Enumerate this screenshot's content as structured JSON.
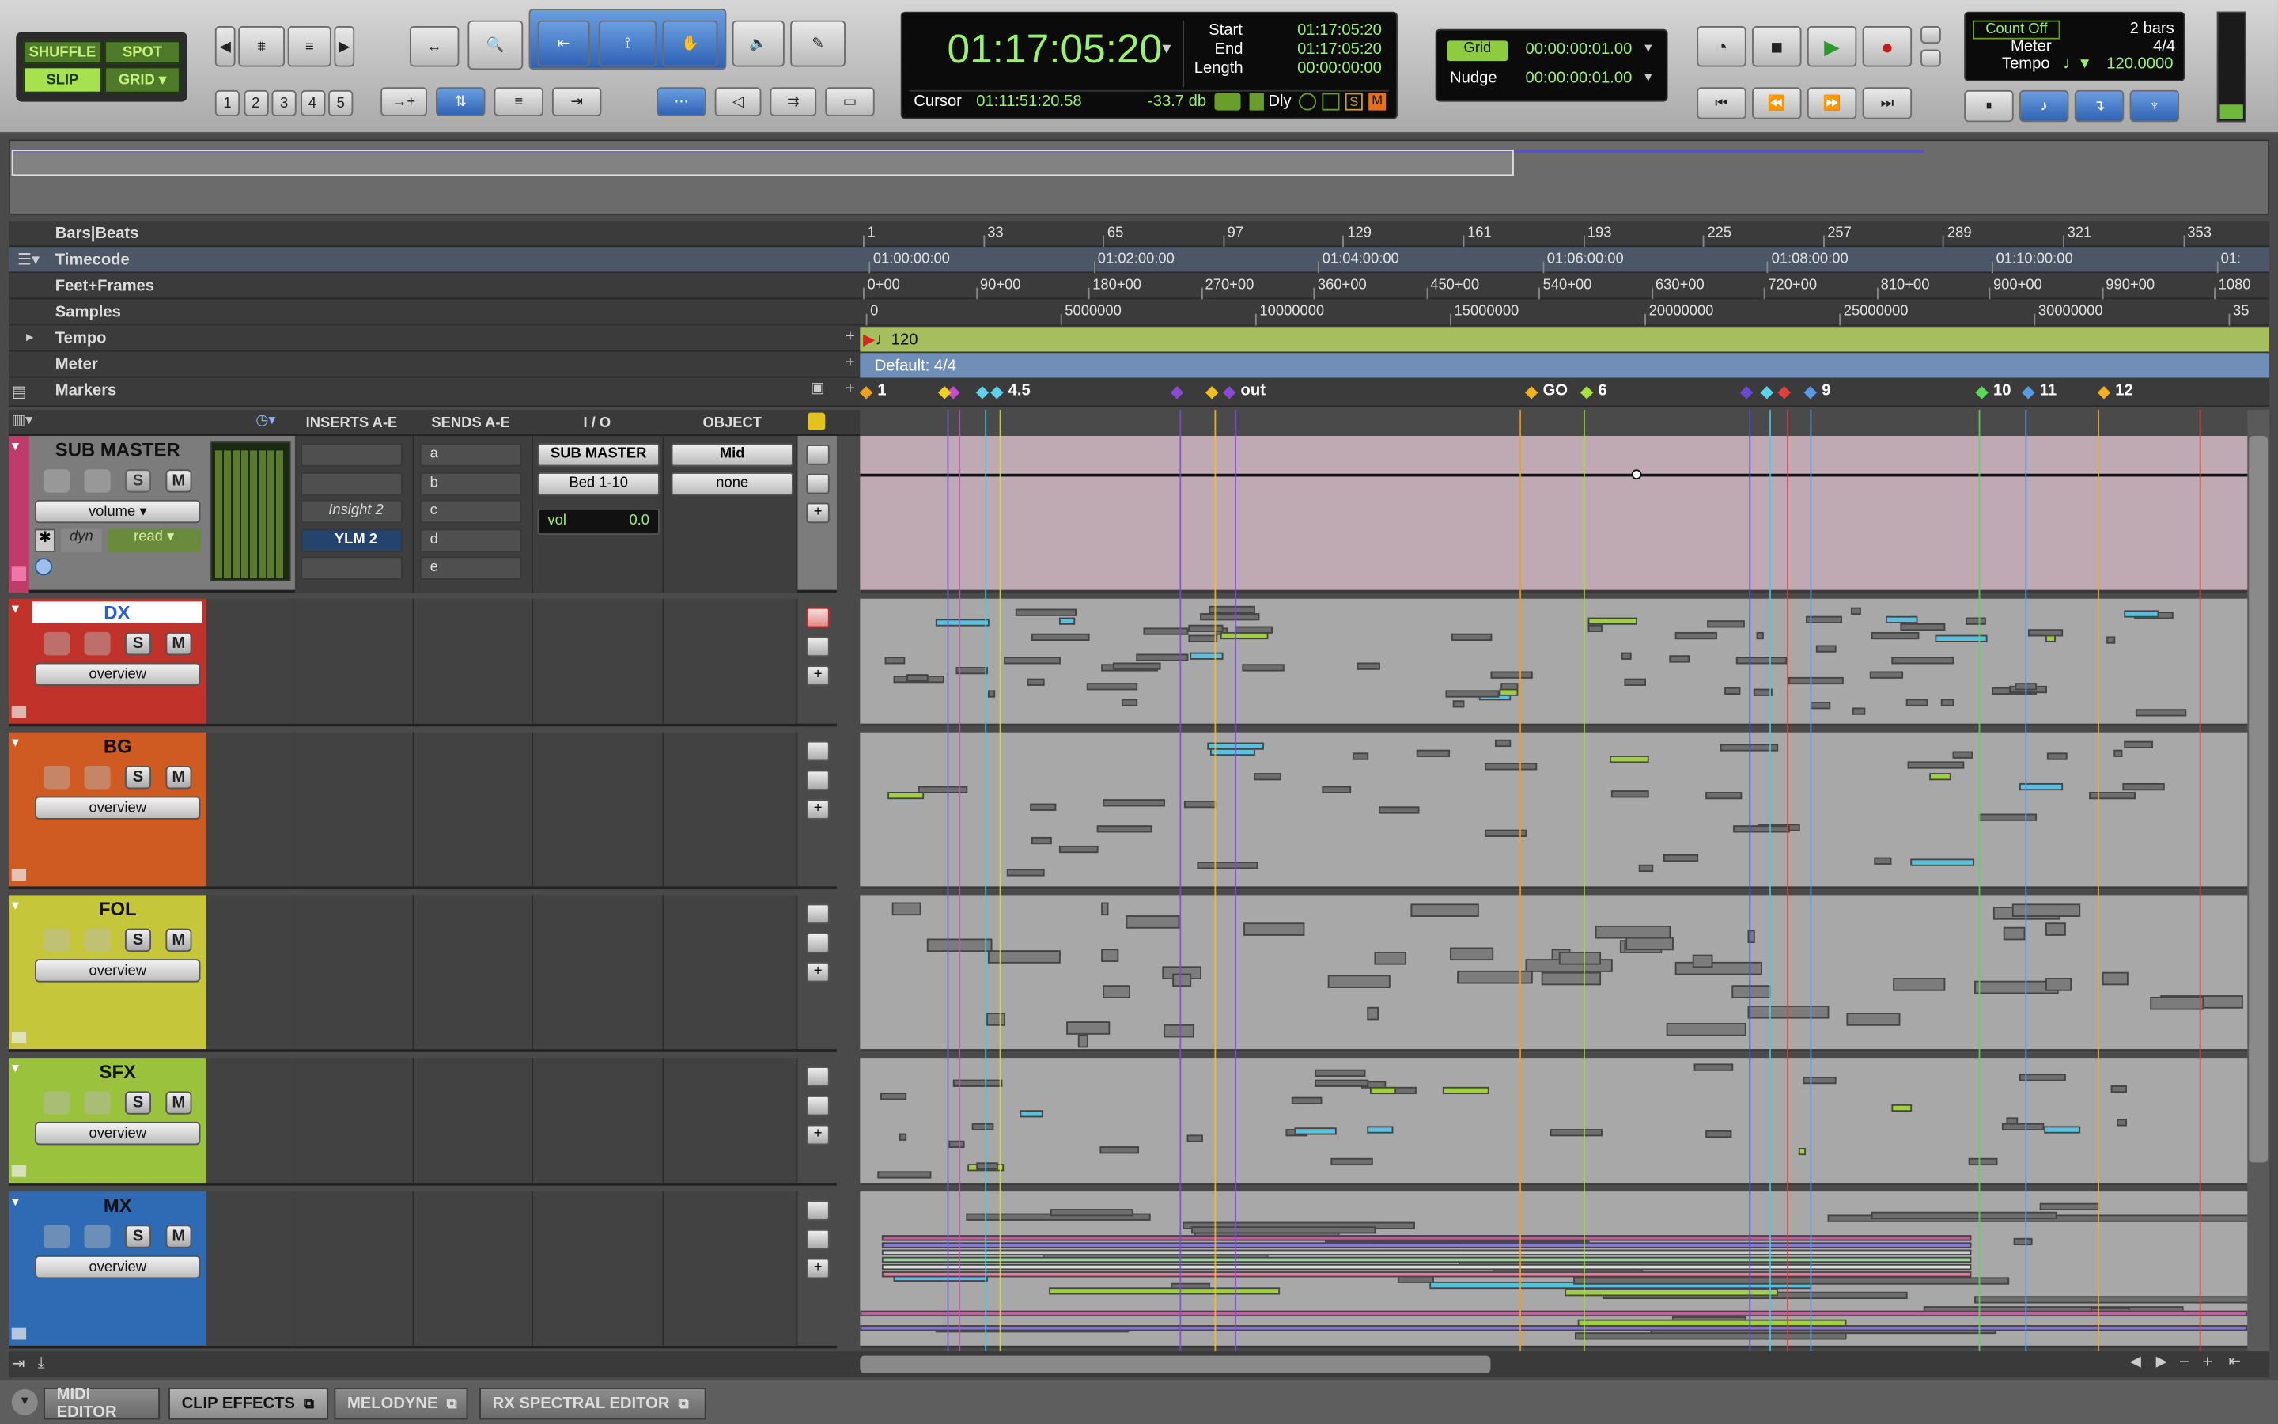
{
  "modes": {
    "shuffle": "SHUFFLE",
    "spot": "SPOT",
    "slip": "SLIP",
    "grid": "GRID"
  },
  "zoom_presets": [
    "1",
    "2",
    "3",
    "4",
    "5"
  ],
  "counter": {
    "main": "01:17:05:20",
    "start_label": "Start",
    "end_label": "End",
    "length_label": "Length",
    "start": "01:17:05:20",
    "end": "01:17:05:20",
    "length": "00:00:00:00",
    "cursor_label": "Cursor",
    "cursor": "01:11:51:20.58",
    "level": "-33.7 db",
    "dly": "Dly"
  },
  "grid": {
    "grid_label": "Grid",
    "grid_value": "00:00:00:01.00",
    "nudge_label": "Nudge",
    "nudge_value": "00:00:00:01.00"
  },
  "midi": {
    "count_off": "Count Off",
    "bars": "2 bars",
    "meter_label": "Meter",
    "meter": "4/4",
    "tempo_label": "Tempo",
    "tempo": "120.0000"
  },
  "rulers": {
    "bars": {
      "name": "Bars|Beats",
      "ticks": [
        "1",
        "33",
        "65",
        "97",
        "129",
        "161",
        "193",
        "225",
        "257",
        "289",
        "321",
        "353"
      ]
    },
    "timecode": {
      "name": "Timecode",
      "ticks": [
        "01:00:00:00",
        "01:02:00:00",
        "01:04:00:00",
        "01:06:00:00",
        "01:08:00:00",
        "01:10:00:00",
        "01:"
      ]
    },
    "feet": {
      "name": "Feet+Frames",
      "ticks": [
        "0+00",
        "90+00",
        "180+00",
        "270+00",
        "360+00",
        "450+00",
        "540+00",
        "630+00",
        "720+00",
        "810+00",
        "900+00",
        "990+00",
        "1080"
      ]
    },
    "samples": {
      "name": "Samples",
      "ticks": [
        "0",
        "5000000",
        "10000000",
        "15000000",
        "20000000",
        "25000000",
        "30000000",
        "35"
      ]
    },
    "tempo": {
      "name": "Tempo",
      "value": "120"
    },
    "meter": {
      "name": "Meter",
      "value": "Default: 4/4"
    },
    "markers": {
      "name": "Markers",
      "items": [
        "1",
        "4.5",
        "out",
        "GO",
        "6",
        "9",
        "10",
        "11",
        "12"
      ]
    }
  },
  "columns": {
    "inserts": "INSERTS A-E",
    "sends": "SENDS A-E",
    "io": "I / O",
    "object": "OBJECT"
  },
  "submaster": {
    "name": "SUB MASTER",
    "automation": "volume",
    "dyn": "dyn",
    "read": "read",
    "inserts": [
      "Insight 2",
      "YLM 2"
    ],
    "sends": [
      "a",
      "b",
      "c",
      "d",
      "e"
    ],
    "output": "SUB MASTER",
    "bus": "Bed 1-10",
    "object": "Mid",
    "object2": "none",
    "vol_label": "vol",
    "vol_value": "0.0"
  },
  "tracks": [
    {
      "name": "DX",
      "view": "overview",
      "color": "#c0322a"
    },
    {
      "name": "BG",
      "view": "overview",
      "color": "#cf5a22"
    },
    {
      "name": "FOL",
      "view": "overview",
      "color": "#c6c63a"
    },
    {
      "name": "SFX",
      "view": "overview",
      "color": "#9ac23c"
    },
    {
      "name": "MX",
      "view": "overview",
      "color": "#2f6bb5"
    }
  ],
  "solo": "S",
  "mute": "M",
  "bottom_tabs": [
    "MIDI EDITOR",
    "CLIP EFFECTS",
    "MELODYNE",
    "RX SPECTRAL EDITOR"
  ]
}
